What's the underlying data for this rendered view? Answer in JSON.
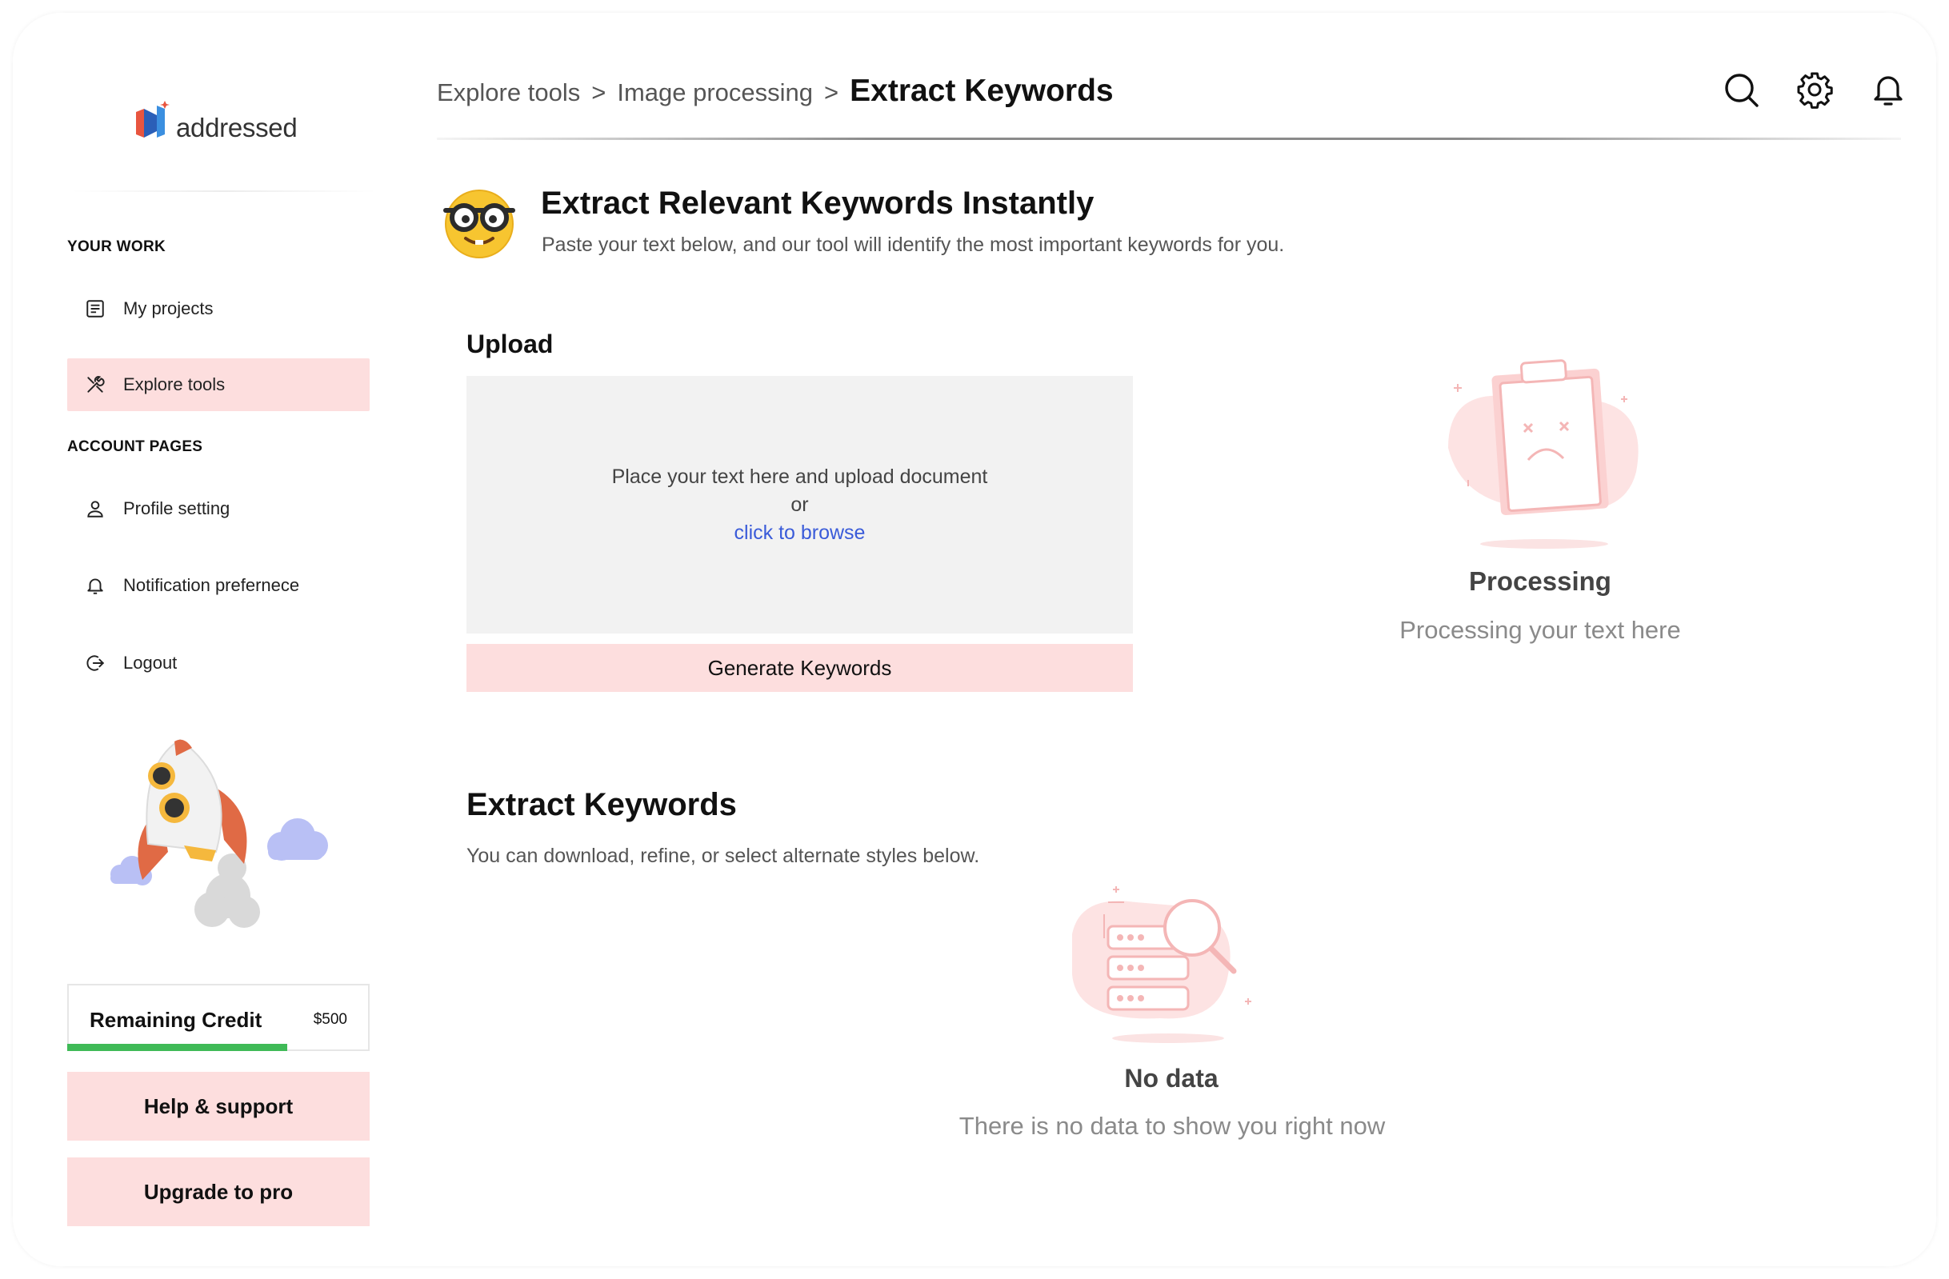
{
  "app": {
    "logo_text": "addressed",
    "brand_colors": {
      "accent_pink": "#fddede",
      "credit_green": "#3fba57",
      "link_blue": "#3a5bd9"
    }
  },
  "sidebar": {
    "section_your_work": "YOUR WORK",
    "section_account": "ACCOUNT PAGES",
    "items": [
      {
        "label": "My projects",
        "icon": "document-list-icon"
      },
      {
        "label": "Explore tools",
        "icon": "tools-icon",
        "active": true
      },
      {
        "label": "Profile setting",
        "icon": "user-icon"
      },
      {
        "label": "Notification prefernece",
        "icon": "bell-icon"
      },
      {
        "label": "Logout",
        "icon": "logout-icon"
      }
    ],
    "credit": {
      "label": "Remaining Credit",
      "value": "$500",
      "progress": 0.73
    },
    "help_label": "Help & support",
    "upgrade_label": "Upgrade to pro"
  },
  "header": {
    "breadcrumb": [
      "Explore tools",
      "Image processing"
    ],
    "separator": ">",
    "current": "Extract Keywords",
    "icons": [
      "search-icon",
      "gear-icon",
      "bell-icon"
    ]
  },
  "hero": {
    "emoji": "nerd-face-emoji",
    "title": "Extract Relevant Keywords Instantly",
    "subtitle": "Paste your text below, and our tool will identify the most important keywords for you."
  },
  "upload": {
    "title": "Upload",
    "drop_text": "Place your text here and upload document",
    "or_text": "or",
    "browse_text": "click to browse",
    "generate_label": "Generate Keywords"
  },
  "processing": {
    "title": "Processing",
    "subtitle": "Processing your text here"
  },
  "results": {
    "title": "Extract Keywords",
    "subtitle": "You can download, refine, or select alternate styles below.",
    "empty_title": "No data",
    "empty_subtitle": "There is no data to show you right now"
  }
}
